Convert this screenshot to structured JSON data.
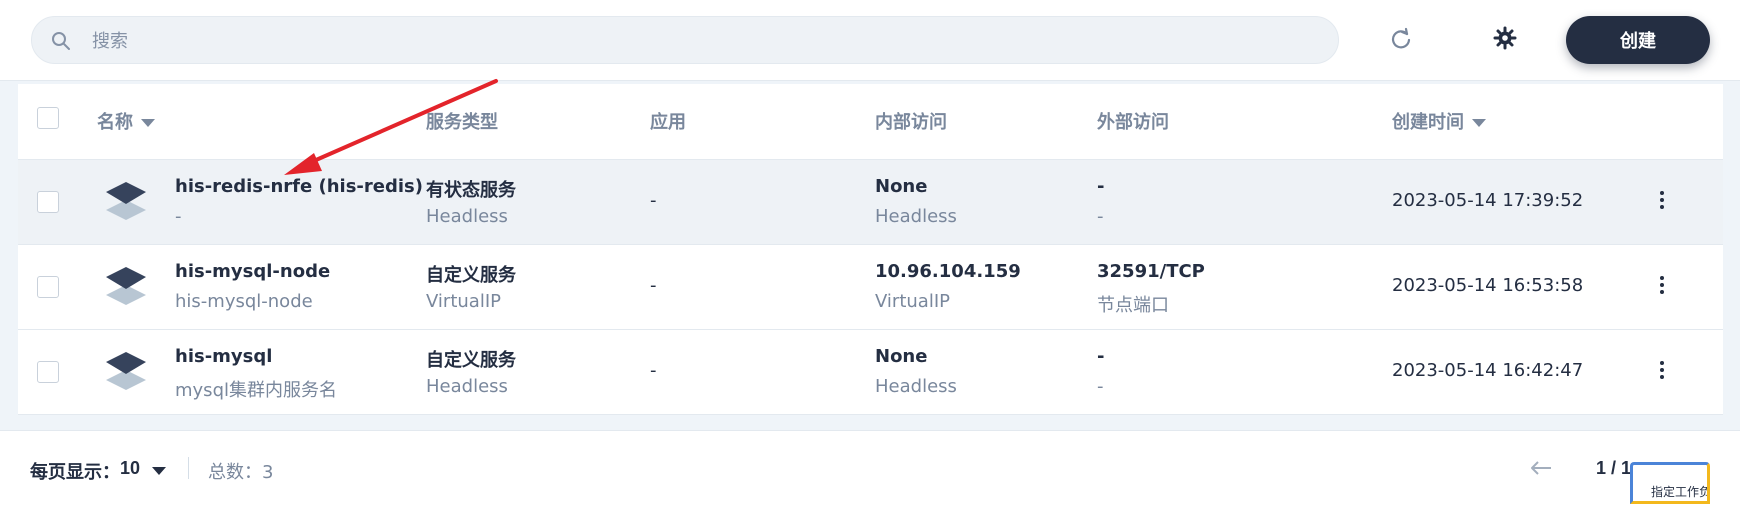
{
  "toolbar": {
    "search_placeholder": "搜索",
    "create_label": "创建"
  },
  "table": {
    "headers": {
      "name": "名称",
      "service_type": "服务类型",
      "app": "应用",
      "internal_access": "内部访问",
      "external_access": "外部访问",
      "created_time": "创建时间"
    },
    "rows": [
      {
        "name": "his-redis-nrfe (his-redis)",
        "alias": "-",
        "type": "有状态服务",
        "type_sub": "Headless",
        "app": "-",
        "internal": "None",
        "internal_sub": "Headless",
        "external": "-",
        "external_sub": "-",
        "created": "2023-05-14 17:39:52"
      },
      {
        "name": "his-mysql-node",
        "alias": "his-mysql-node",
        "type": "自定义服务",
        "type_sub": "VirtualIP",
        "app": "-",
        "internal": "10.96.104.159",
        "internal_sub": "VirtualIP",
        "external": "32591/TCP",
        "external_sub": "节点端口",
        "created": "2023-05-14 16:53:58"
      },
      {
        "name": "his-mysql",
        "alias": "mysql集群内服务名",
        "type": "自定义服务",
        "type_sub": "Headless",
        "app": "-",
        "internal": "None",
        "internal_sub": "Headless",
        "external": "-",
        "external_sub": "-",
        "created": "2023-05-14 16:42:47"
      }
    ]
  },
  "footer": {
    "per_page_label": "每页显示：",
    "per_page_value": "10",
    "total_label": "总数：3",
    "page_indicator": "1 / 1"
  },
  "widget": {
    "label": "指定工作负"
  },
  "colors": {
    "accent_dark": "#242e42",
    "muted_text": "#79879c",
    "annotation_red": "#e3242b"
  },
  "icons": [
    "search-icon",
    "refresh-icon",
    "gear-icon",
    "caret-down-icon",
    "service-icon",
    "more-vertical-icon",
    "arrow-left-icon"
  ]
}
